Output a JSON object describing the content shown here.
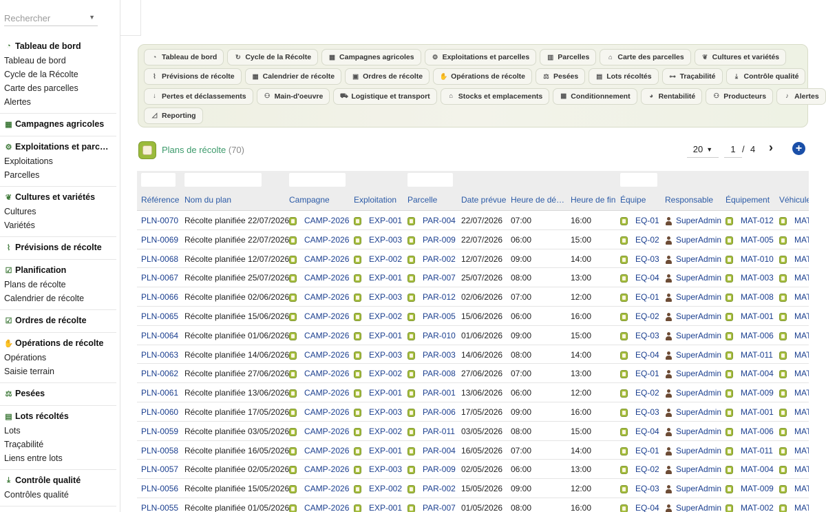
{
  "search": {
    "placeholder": "Rechercher"
  },
  "sidebar": {
    "groups": [
      {
        "label": "Tableau de bord",
        "icon": "dashboard-icon",
        "items": [
          "Tableau de bord",
          "Cycle de la Récolte",
          "Carte des parcelles",
          "Alertes"
        ]
      },
      {
        "label": "Campagnes agricoles",
        "icon": "calendar-icon",
        "items": []
      },
      {
        "label": "Exploitations et parc…",
        "icon": "tractor-icon",
        "items": [
          "Exploitations",
          "Parcelles"
        ]
      },
      {
        "label": "Cultures et variétés",
        "icon": "seedling-icon",
        "items": [
          "Cultures",
          "Variétés"
        ]
      },
      {
        "label": "Prévisions de récolte",
        "icon": "chart-line-icon",
        "items": []
      },
      {
        "label": "Planification",
        "icon": "clipboard-check-icon",
        "items": [
          "Plans de récolte",
          "Calendrier de récolte"
        ]
      },
      {
        "label": "Ordres de récolte",
        "icon": "clipboard-check-icon",
        "items": []
      },
      {
        "label": "Opérations de récolte",
        "icon": "hand-icon",
        "items": [
          "Opérations",
          "Saisie terrain"
        ]
      },
      {
        "label": "Pesées",
        "icon": "scale-icon",
        "items": []
      },
      {
        "label": "Lots récoltés",
        "icon": "boxes-icon",
        "items": [
          "Lots",
          "Traçabilité",
          "Liens entre lots"
        ]
      },
      {
        "label": "Contrôle qualité",
        "icon": "hand-holding-icon",
        "items": [
          "Contrôles qualité"
        ]
      }
    ]
  },
  "nav": {
    "rows": [
      [
        {
          "label": "Tableau de bord",
          "icon": "dashboard-icon"
        },
        {
          "label": "Cycle de la Récolte",
          "icon": "refresh-icon"
        },
        {
          "label": "Campagnes agricoles",
          "icon": "calendar-icon"
        },
        {
          "label": "Exploitations et parcelles",
          "icon": "tractor-icon"
        },
        {
          "label": "Parcelles",
          "icon": "map-icon"
        },
        {
          "label": "Carte des parcelles",
          "icon": "map-marked-icon"
        },
        {
          "label": "Cultures et variétés",
          "icon": "seedling-icon"
        }
      ],
      [
        {
          "label": "Prévisions de récolte",
          "icon": "chart-line-icon"
        },
        {
          "label": "Calendrier de récolte",
          "icon": "calendar-icon"
        },
        {
          "label": "Ordres de récolte",
          "icon": "clipboard-icon"
        },
        {
          "label": "Opérations de récolte",
          "icon": "hand-icon"
        },
        {
          "label": "Pesées",
          "icon": "scale-icon"
        },
        {
          "label": "Lots récoltés",
          "icon": "boxes-icon"
        },
        {
          "label": "Traçabilité",
          "icon": "project-diagram-icon"
        },
        {
          "label": "Contrôle qualité",
          "icon": "hand-holding-icon"
        }
      ],
      [
        {
          "label": "Pertes et déclassements",
          "icon": "arrow-down-icon"
        },
        {
          "label": "Main-d'oeuvre",
          "icon": "users-icon"
        },
        {
          "label": "Logistique et transport",
          "icon": "truck-icon"
        },
        {
          "label": "Stocks et emplacements",
          "icon": "warehouse-icon"
        },
        {
          "label": "Conditionnement",
          "icon": "cubes-icon"
        },
        {
          "label": "Rentabilité",
          "icon": "pie-chart-icon"
        },
        {
          "label": "Producteurs",
          "icon": "users-icon"
        },
        {
          "label": "Alertes",
          "icon": "bell-icon"
        }
      ],
      [
        {
          "label": "Reporting",
          "icon": "chart-area-icon"
        }
      ]
    ]
  },
  "list": {
    "title": "Plans de récolte",
    "count": "(70)",
    "page_size": "20",
    "page_current": "1",
    "page_sep": "/",
    "page_total": "4"
  },
  "table": {
    "columns": [
      "Référence",
      "Nom du plan",
      "Campagne",
      "Exploitation",
      "Parcelle",
      "Date prévue",
      "Heure de dé…",
      "Heure de fin",
      "Équipe",
      "Responsable",
      "Équipement",
      "Véhicule"
    ],
    "rows": [
      [
        "PLN-0070",
        "Récolte planifiée 22/07/2026",
        "CAMP-2026",
        "EXP-001",
        "PAR-004",
        "22/07/2026",
        "07:00",
        "16:00",
        "EQ-01",
        "SuperAdmin",
        "MAT-012",
        "MAT"
      ],
      [
        "PLN-0069",
        "Récolte planifiée 22/07/2026",
        "CAMP-2026",
        "EXP-003",
        "PAR-009",
        "22/07/2026",
        "06:00",
        "15:00",
        "EQ-02",
        "SuperAdmin",
        "MAT-005",
        "MAT"
      ],
      [
        "PLN-0068",
        "Récolte planifiée 12/07/2026",
        "CAMP-2026",
        "EXP-002",
        "PAR-002",
        "12/07/2026",
        "09:00",
        "14:00",
        "EQ-03",
        "SuperAdmin",
        "MAT-010",
        "MAT"
      ],
      [
        "PLN-0067",
        "Récolte planifiée 25/07/2026",
        "CAMP-2026",
        "EXP-001",
        "PAR-007",
        "25/07/2026",
        "08:00",
        "13:00",
        "EQ-04",
        "SuperAdmin",
        "MAT-003",
        "MAT"
      ],
      [
        "PLN-0066",
        "Récolte planifiée 02/06/2026",
        "CAMP-2026",
        "EXP-003",
        "PAR-012",
        "02/06/2026",
        "07:00",
        "12:00",
        "EQ-01",
        "SuperAdmin",
        "MAT-008",
        "MAT"
      ],
      [
        "PLN-0065",
        "Récolte planifiée 15/06/2026",
        "CAMP-2026",
        "EXP-002",
        "PAR-005",
        "15/06/2026",
        "06:00",
        "16:00",
        "EQ-02",
        "SuperAdmin",
        "MAT-001",
        "MAT"
      ],
      [
        "PLN-0064",
        "Récolte planifiée 01/06/2026",
        "CAMP-2026",
        "EXP-001",
        "PAR-010",
        "01/06/2026",
        "09:00",
        "15:00",
        "EQ-03",
        "SuperAdmin",
        "MAT-006",
        "MAT"
      ],
      [
        "PLN-0063",
        "Récolte planifiée 14/06/2026",
        "CAMP-2026",
        "EXP-003",
        "PAR-003",
        "14/06/2026",
        "08:00",
        "14:00",
        "EQ-04",
        "SuperAdmin",
        "MAT-011",
        "MAT"
      ],
      [
        "PLN-0062",
        "Récolte planifiée 27/06/2026",
        "CAMP-2026",
        "EXP-002",
        "PAR-008",
        "27/06/2026",
        "07:00",
        "13:00",
        "EQ-01",
        "SuperAdmin",
        "MAT-004",
        "MAT"
      ],
      [
        "PLN-0061",
        "Récolte planifiée 13/06/2026",
        "CAMP-2026",
        "EXP-001",
        "PAR-001",
        "13/06/2026",
        "06:00",
        "12:00",
        "EQ-02",
        "SuperAdmin",
        "MAT-009",
        "MAT"
      ],
      [
        "PLN-0060",
        "Récolte planifiée 17/05/2026",
        "CAMP-2026",
        "EXP-003",
        "PAR-006",
        "17/05/2026",
        "09:00",
        "16:00",
        "EQ-03",
        "SuperAdmin",
        "MAT-001",
        "MAT"
      ],
      [
        "PLN-0059",
        "Récolte planifiée 03/05/2026",
        "CAMP-2026",
        "EXP-002",
        "PAR-011",
        "03/05/2026",
        "08:00",
        "15:00",
        "EQ-04",
        "SuperAdmin",
        "MAT-006",
        "MAT"
      ],
      [
        "PLN-0058",
        "Récolte planifiée 16/05/2026",
        "CAMP-2026",
        "EXP-001",
        "PAR-004",
        "16/05/2026",
        "07:00",
        "14:00",
        "EQ-01",
        "SuperAdmin",
        "MAT-011",
        "MAT"
      ],
      [
        "PLN-0057",
        "Récolte planifiée 02/05/2026",
        "CAMP-2026",
        "EXP-003",
        "PAR-009",
        "02/05/2026",
        "06:00",
        "13:00",
        "EQ-02",
        "SuperAdmin",
        "MAT-004",
        "MAT"
      ],
      [
        "PLN-0056",
        "Récolte planifiée 15/05/2026",
        "CAMP-2026",
        "EXP-002",
        "PAR-002",
        "15/05/2026",
        "09:00",
        "12:00",
        "EQ-03",
        "SuperAdmin",
        "MAT-009",
        "MAT"
      ],
      [
        "PLN-0055",
        "Récolte planifiée 01/05/2026",
        "CAMP-2026",
        "EXP-001",
        "PAR-007",
        "01/05/2026",
        "08:00",
        "16:00",
        "EQ-04",
        "SuperAdmin",
        "MAT-002",
        "MAT"
      ]
    ]
  }
}
